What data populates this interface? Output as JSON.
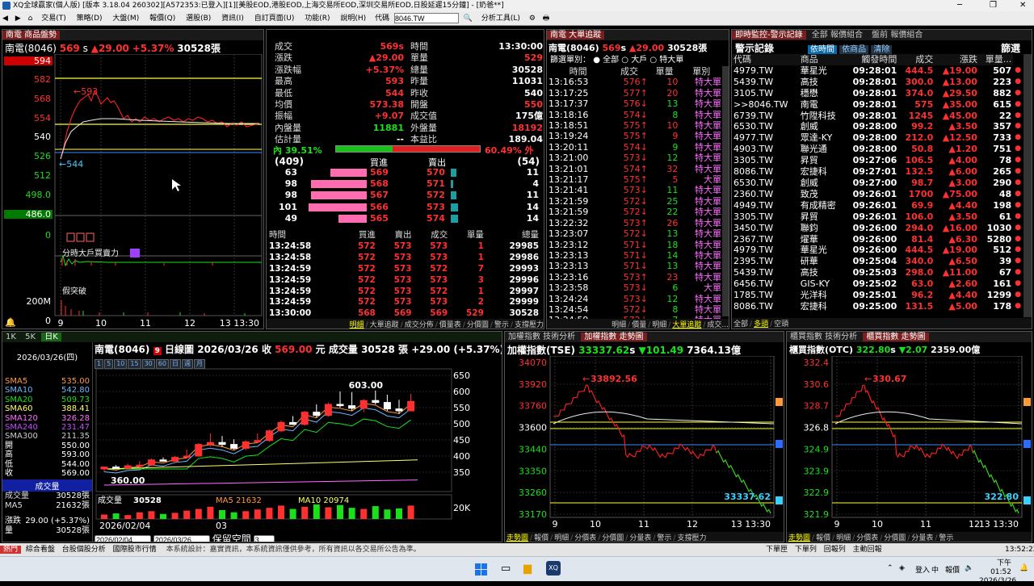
{
  "window": {
    "title": "XQ全球贏家(個人版) [版本 3.18.04 260302][A572353:已登入][1][美股EOD,港股EOD,上海交易所EOD,深圳交易所EOD,日股延遲15分鐘] - [奶爸**]"
  },
  "menu": {
    "items": [
      "交易(T)",
      "策略(D)",
      "大盤(M)",
      "報價(Q)",
      "選股(B)",
      "資訊(I)",
      "自訂頁面(U)",
      "功能(R)",
      "說明(H)",
      "分析工具(L)"
    ],
    "code_label": "代碼",
    "code_value": "8046.TW"
  },
  "p1": {
    "tab": "南電 商品盤勢",
    "stock": "南電(8046)",
    "price": "569",
    "unit": "s",
    "chg": "▲29.00",
    "pct": "+5.37%",
    "vol": "30528張",
    "yticks": [
      "594",
      "582",
      "568",
      "554",
      "540",
      "526",
      "512",
      "498.0",
      "486.0",
      "0"
    ],
    "hi_label": "593",
    "lo_label": "544",
    "xticks": [
      "9",
      "10",
      "11",
      "12",
      "13 13:30"
    ],
    "sub1": "分時大戶買賣力",
    "sub2": "假突破",
    "sub2_tick": "200M",
    "sub2_zero": "0",
    "bottom_tabs": [
      "明細",
      "大單追蹤",
      "成交分佈",
      "價量表",
      "分價圖",
      "警示",
      "支撐壓力"
    ]
  },
  "quote": {
    "left": [
      [
        "成交",
        "569s"
      ],
      [
        "漲跌",
        "▲29.00"
      ],
      [
        "漲跌幅",
        "+5.37%"
      ],
      [
        "最高",
        "593"
      ],
      [
        "最低",
        "544"
      ],
      [
        "均價",
        "573.38"
      ],
      [
        "振幅",
        "+9.07"
      ],
      [
        "內盤量",
        "11881"
      ],
      [
        "估計量",
        "--"
      ]
    ],
    "right": [
      [
        "時間",
        "13:30:00"
      ],
      [
        "單量",
        "529"
      ],
      [
        "總量",
        "30528"
      ],
      [
        "昨量",
        "11031"
      ],
      [
        "昨收",
        "540"
      ],
      [
        "開盤",
        "550"
      ],
      [
        "成交值",
        "175億"
      ],
      [
        "外盤量",
        "18192"
      ],
      [
        "本益比",
        "189.04"
      ]
    ],
    "in_pct": "內 39.51%",
    "out_pct": "60.49% 外",
    "buy_total": "(409)",
    "sell_total": "(54)",
    "bid_h": "買進",
    "ask_h": "賣出"
  },
  "depth": [
    {
      "bq": "63",
      "bp": "569",
      "ap": "570",
      "aq": "11",
      "bw": 0.62,
      "aw": 0.2
    },
    {
      "bq": "98",
      "bp": "568",
      "ap": "571",
      "aq": "4",
      "bw": 0.96,
      "aw": 0.07
    },
    {
      "bq": "98",
      "bp": "567",
      "ap": "572",
      "aq": "11",
      "bw": 0.96,
      "aw": 0.2
    },
    {
      "bq": "101",
      "bp": "566",
      "ap": "573",
      "aq": "14",
      "bw": 1.0,
      "aw": 0.26
    },
    {
      "bq": "49",
      "bp": "565",
      "ap": "574",
      "aq": "14",
      "bw": 0.48,
      "aw": 0.26
    }
  ],
  "ticks": {
    "headers": [
      "時間",
      "買進",
      "賣出",
      "成交",
      "單量",
      "總量"
    ],
    "rows": [
      [
        "13:24:58",
        "572",
        "573",
        "573",
        "1",
        "29985"
      ],
      [
        "13:24:58",
        "572",
        "573",
        "573",
        "1",
        "29986"
      ],
      [
        "13:24:59",
        "572",
        "573",
        "572",
        "7",
        "29993"
      ],
      [
        "13:24:59",
        "572",
        "573",
        "573",
        "3",
        "29996"
      ],
      [
        "13:24:59",
        "572",
        "573",
        "572",
        "1",
        "29997"
      ],
      [
        "13:24:59",
        "572",
        "573",
        "573",
        "2",
        "29999"
      ],
      [
        "13:30:00",
        "568",
        "569",
        "569",
        "529",
        "30528"
      ]
    ]
  },
  "bigorder": {
    "tab": "南電 大單追蹤",
    "stock": "南電(8046)",
    "price": "569",
    "unit": "s",
    "chg": "▲29.00",
    "vol": "30528張",
    "filter_label": "篩選單別：",
    "filters": [
      "全部",
      "大戶",
      "特大單"
    ],
    "headers": [
      "時間",
      "成交",
      "單量",
      "單別"
    ],
    "rows": [
      [
        "13:16:53",
        "576↑",
        "10",
        "特大單"
      ],
      [
        "13:17:25",
        "577↑",
        "20",
        "特大單"
      ],
      [
        "13:17:37",
        "576↓",
        "13",
        "特大單"
      ],
      [
        "13:18:16",
        "574↓",
        "8",
        "特大單"
      ],
      [
        "13:18:51",
        "575↑",
        "10",
        "特大單"
      ],
      [
        "13:19:24",
        "575↑",
        "9",
        "特大單"
      ],
      [
        "13:20:11",
        "574↓",
        "9",
        "特大單"
      ],
      [
        "13:21:00",
        "573↓",
        "12",
        "特大單"
      ],
      [
        "13:21:01",
        "574↑",
        "32",
        "特大單"
      ],
      [
        "13:21:17",
        "575↑",
        "5",
        "大單"
      ],
      [
        "13:21:41",
        "573↓",
        "11",
        "特大單"
      ],
      [
        "13:21:59",
        "572↓",
        "25",
        "特大單"
      ],
      [
        "13:21:59",
        "572↓",
        "22",
        "特大單"
      ],
      [
        "13:22:32",
        "573↑",
        "26",
        "特大單"
      ],
      [
        "13:23:07",
        "572↓",
        "13",
        "特大單"
      ],
      [
        "13:23:12",
        "571↓",
        "18",
        "特大單"
      ],
      [
        "13:23:13",
        "571↓",
        "14",
        "特大單"
      ],
      [
        "13:23:13",
        "571↓",
        "13",
        "特大單"
      ],
      [
        "13:23:16",
        "573↑",
        "23",
        "特大單"
      ],
      [
        "13:23:58",
        "573↓",
        "6",
        "大單"
      ],
      [
        "13:24:24",
        "573↓",
        "12",
        "特大單"
      ],
      [
        "13:24:54",
        "572↓",
        "8",
        "特大單"
      ],
      [
        "13:24:59",
        "572↓",
        "7",
        "特大單"
      ]
    ],
    "bottom_tabs": [
      "明細",
      "價量",
      "明細",
      "大單追蹤",
      "成交..."
    ]
  },
  "alert": {
    "tabs": [
      "即時監控-警示記錄",
      "全部 報價組合",
      "盤前 報價組合"
    ],
    "title": "警示記錄",
    "sub_tabs": [
      "依時間",
      "依商品",
      "清除"
    ],
    "filter_btn": "篩選",
    "headers": [
      "代碼",
      "商品",
      "觸發時間",
      "成交",
      "漲跌",
      "單量..."
    ],
    "rows": [
      [
        "4979.TW",
        "華星光",
        "09:28:01",
        "444.5",
        "▲19.00",
        "507",
        "red"
      ],
      [
        "5439.TW",
        "高技",
        "09:28:01",
        "300.0",
        "▲13.00",
        "223",
        "red"
      ],
      [
        "3105.TW",
        "穩懋",
        "09:28:01",
        "374.0",
        "▲29.50",
        "882",
        "red"
      ],
      [
        ">>8046.TW",
        "南電",
        "09:28:01",
        "575",
        "▲35.00",
        "615",
        "red"
      ],
      [
        "6739.TW",
        "竹陞科技",
        "09:28:01",
        "1245",
        "▲45.00",
        "22",
        "red"
      ],
      [
        "6530.TW",
        "創威",
        "09:28:00",
        "99.2",
        "▲3.50",
        "357",
        "red"
      ],
      [
        "4977.TW",
        "眾達-KY",
        "09:28:00",
        "212.0",
        "▲12.50",
        "733",
        "red"
      ],
      [
        "4903.TW",
        "聯光通",
        "09:28:00",
        "50.8",
        "▲1.20",
        "751",
        "red"
      ],
      [
        "3305.TW",
        "昇貿",
        "09:27:06",
        "106.5",
        "▲4.00",
        "78",
        "red"
      ],
      [
        "8086.TW",
        "宏捷科",
        "09:27:01",
        "132.5",
        "▲6.00",
        "265",
        "red"
      ],
      [
        "6530.TW",
        "創威",
        "09:27:00",
        "98.7",
        "▲3.00",
        "290",
        "red"
      ],
      [
        "2360.TW",
        "致茂",
        "09:26:01",
        "1700",
        "▲75.00",
        "48",
        "red"
      ],
      [
        "4949.TW",
        "有成精密",
        "09:26:01",
        "69.9",
        "▲4.40",
        "198",
        "red"
      ],
      [
        "3305.TW",
        "昇貿",
        "09:26:01",
        "106.0",
        "▲3.50",
        "61",
        "red"
      ],
      [
        "3450.TW",
        "聯鈞",
        "09:26:00",
        "294.0",
        "▲16.00",
        "1030",
        "red"
      ],
      [
        "2367.TW",
        "燿華",
        "09:26:00",
        "81.4",
        "▲6.30",
        "5280",
        "red"
      ],
      [
        "4979.TW",
        "華星光",
        "09:26:00",
        "444.5",
        "▲19.00",
        "512",
        "red"
      ],
      [
        "2395.TW",
        "研華",
        "09:25:04",
        "340.0",
        "▲6.50",
        "39",
        "red"
      ],
      [
        "5439.TW",
        "高技",
        "09:25:03",
        "298.0",
        "▲11.00",
        "67",
        "red"
      ],
      [
        "6456.TW",
        "GIS-KY",
        "09:25:02",
        "63.0",
        "▲2.60",
        "161",
        "red"
      ],
      [
        "1785.TW",
        "光洋科",
        "09:25:01",
        "96.2",
        "▲4.40",
        "1299",
        "red"
      ],
      [
        "8086.TW",
        "宏捷科",
        "09:25:00",
        "131.5",
        "▲5.00",
        "178",
        "red"
      ]
    ],
    "bottom_tabs": [
      "全部",
      "多頭",
      "空頭"
    ]
  },
  "kline": {
    "tabs": [
      "1K",
      "5K",
      "日K"
    ],
    "stock": "南電(8046)",
    "period": "日線圖",
    "date": "2026/03/26",
    "close_label": "收",
    "close": "569.00",
    "unit": "元",
    "vol_label": "成交量",
    "vol": "30528 張",
    "chg": "+29.00 (+5.37%)",
    "date_display": "2026/03/26(四)",
    "sma": [
      {
        "k": "SMA5",
        "v": "535.00",
        "c": "#ff9a3c"
      },
      {
        "k": "SMA10",
        "v": "542.80",
        "c": "#6cb7ff"
      },
      {
        "k": "SMA20",
        "v": "509.73",
        "c": "#19e019"
      },
      {
        "k": "SMA60",
        "v": "388.41",
        "c": "#ffff66"
      },
      {
        "k": "SMA120",
        "v": "326.28",
        "c": "#ff6cff"
      },
      {
        "k": "SMA240",
        "v": "231.47",
        "c": "#c04cff"
      },
      {
        "k": "SMA300",
        "v": "211.35",
        "c": "#cccccc"
      }
    ],
    "ohlc": [
      [
        "開",
        "550.00"
      ],
      [
        "高",
        "593.00"
      ],
      [
        "低",
        "544.00"
      ],
      [
        "收",
        "569.00"
      ]
    ],
    "volsec": "成交量",
    "volrows": [
      [
        "成交量",
        "30528張"
      ],
      [
        "MA5",
        "21632張"
      ]
    ],
    "lastrow": [
      [
        "漲跌",
        "29.00 (+5.37%)"
      ],
      [
        "量",
        "30528張"
      ]
    ],
    "yticks": [
      "650",
      "600",
      "550",
      "500",
      "450",
      "400",
      "350"
    ],
    "hi": "603.00",
    "lo": "360.00",
    "vol_value": "30528",
    "ma5": "MA5 21632",
    "ma10": "MA10 20974",
    "vol_tick": "20K",
    "xdates": [
      "2026/02/04",
      "03"
    ],
    "start": "2026/02/04",
    "end": "2026/03/26",
    "space_label": "保留空間",
    "space_val": "3"
  },
  "taiex": {
    "tabs": [
      "加權指數 技術分析",
      "加權指數 走勢圖"
    ],
    "name": "加權指數(TSE)",
    "value": "33337.62",
    "unit": "s",
    "chg": "▼101.49",
    "amount": "7364.13億",
    "yticks": [
      "34070",
      "33920",
      "33760",
      "33600",
      "33440",
      "33350",
      "33260",
      "33170"
    ],
    "hi": "33892.56",
    "last": "33337.62",
    "xticks": [
      "9",
      "10",
      "11",
      "12",
      "13 13:30"
    ],
    "bottom_tabs": [
      "走勢圖",
      "報價",
      "明細",
      "分價表",
      "分價圖",
      "分量表",
      "警示",
      "支撐壓力"
    ]
  },
  "otc": {
    "tabs": [
      "櫃買指數 技術分析",
      "櫃買指數 走勢圖"
    ],
    "name": "櫃買指數(OTC)",
    "value": "322.80",
    "unit": "s",
    "chg": "▼2.07",
    "amount": "2359.00億",
    "yticks": [
      "332.4",
      "330.6",
      "328.7",
      "326.8",
      "324.9",
      "323.9",
      "322.9",
      "321.9"
    ],
    "hi": "330.67",
    "last": "322.80",
    "xticks": [
      "9",
      "10",
      "11",
      "12",
      "13 13:30"
    ],
    "bottom_tabs": [
      "走勢圖",
      "報價",
      "明細",
      "分價表",
      "分價圖",
      "分量表",
      "警示"
    ]
  },
  "statusbar": {
    "items": [
      "熱門",
      "綜合看盤",
      "台股個股分析",
      "國際股市行情"
    ],
    "disclaimer": "本系統設計：嘉實資訊，本系統資訊僅供參考，所有資訊以各交易所公告為準。",
    "right": [
      "下單匣",
      "下單列",
      "回報列",
      "主動回報"
    ],
    "time": "13:52:22"
  },
  "taskbar": {
    "tray": [
      "登入",
      "報價"
    ],
    "clock_time": "下午 01:52",
    "clock_date": "2026/3/26"
  },
  "colors": {
    "up": "#ff3030",
    "down": "#19e019",
    "panel_tab": "#7a1f1f",
    "bg": "#000000"
  }
}
